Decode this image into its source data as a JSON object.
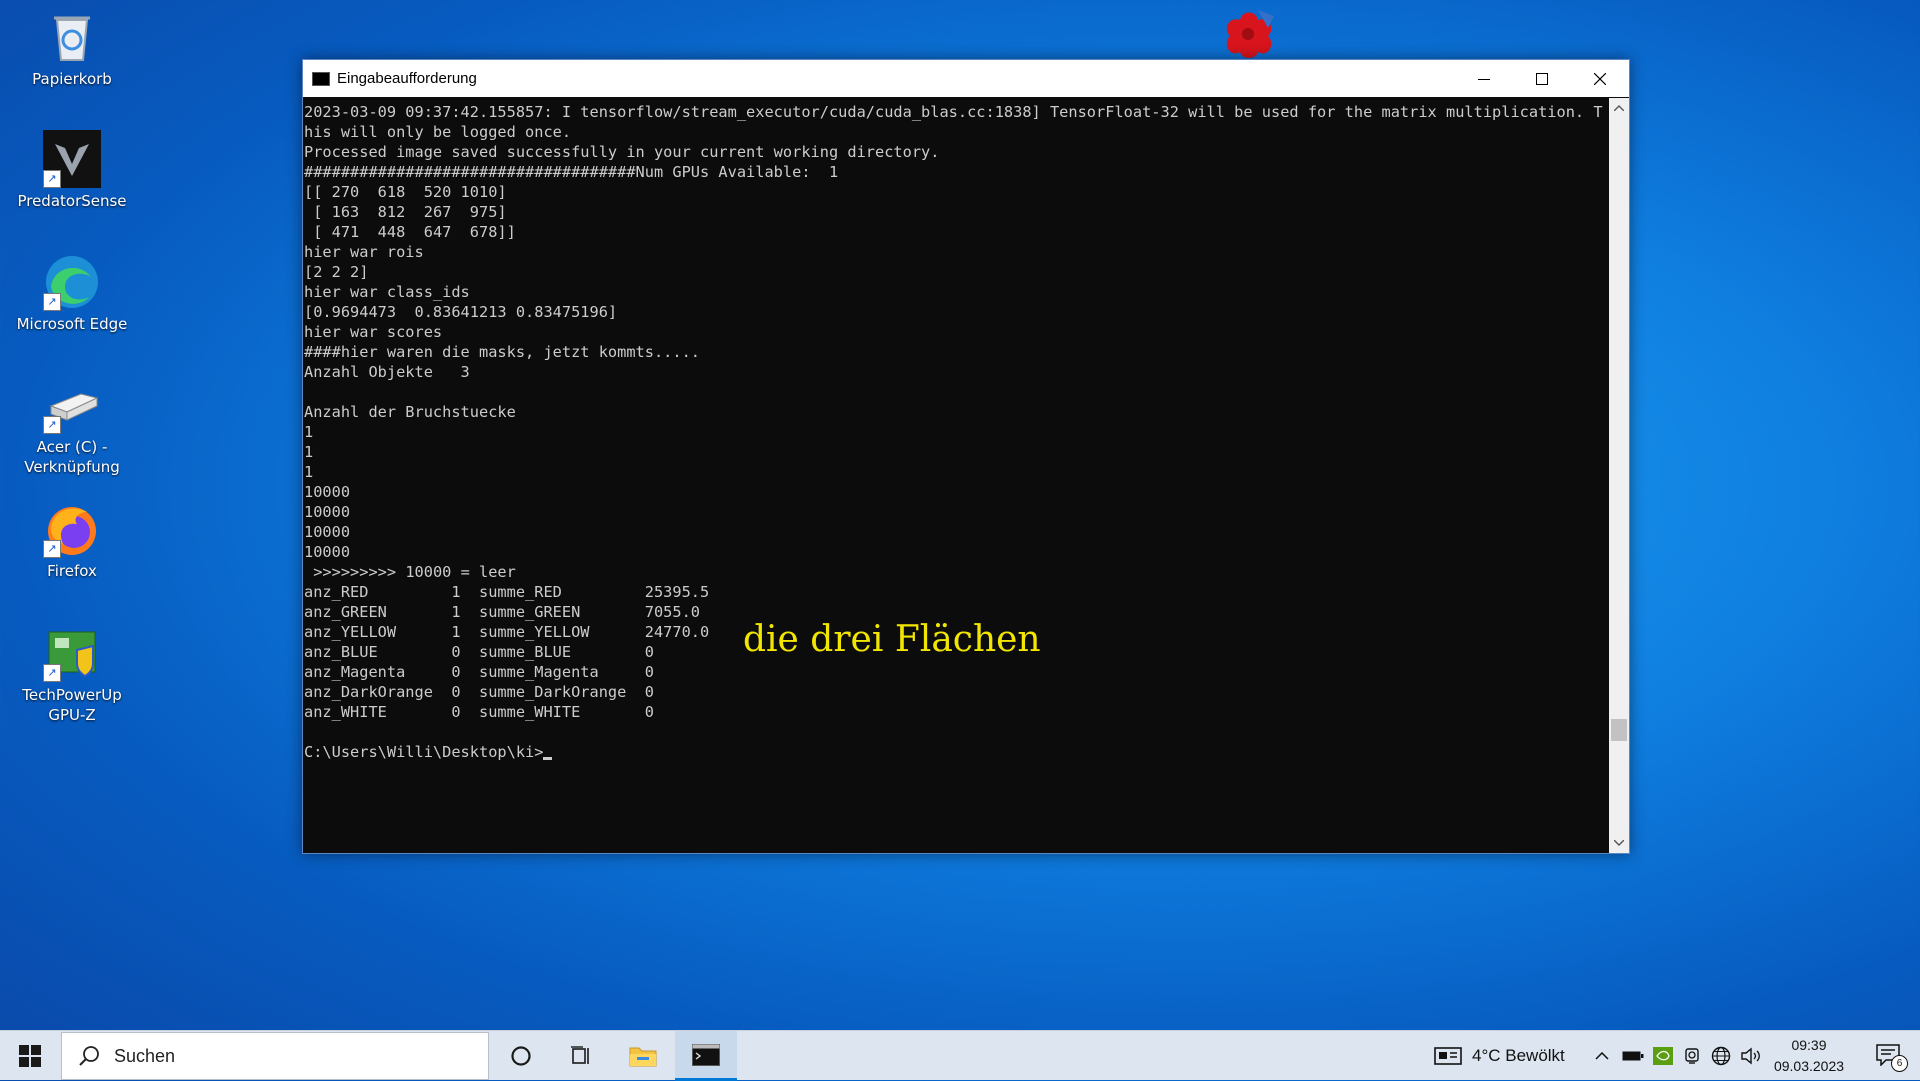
{
  "desktop": {
    "icons": [
      {
        "label": "Papierkorb",
        "icon": "recycle-bin-icon"
      },
      {
        "label": "PredatorSense",
        "icon": "predatorsense-icon"
      },
      {
        "label": "Microsoft Edge",
        "icon": "edge-icon"
      },
      {
        "label": "Acer (C) - Verknüpfung",
        "icon": "drive-icon"
      },
      {
        "label": "Firefox",
        "icon": "firefox-icon"
      },
      {
        "label": "TechPowerUp GPU-Z",
        "icon": "gpu-z-icon"
      }
    ]
  },
  "window": {
    "title": "Eingabeaufforderung",
    "buttons": {
      "minimize": "minimize-icon",
      "maximize": "maximize-icon",
      "close": "close-icon"
    },
    "lines": [
      "2023-03-09 09:37:42.155857: I tensorflow/stream_executor/cuda/cuda_blas.cc:1838] TensorFloat-32 will be used for the matrix multiplication. This will only be logged once.",
      "Processed image saved successfully in your current working directory.",
      "####################################Num GPUs Available:  1",
      "[[ 270  618  520 1010]",
      " [ 163  812  267  975]",
      " [ 471  448  647  678]]",
      "hier war rois",
      "[2 2 2]",
      "hier war class_ids",
      "[0.9694473  0.83641213 0.83475196]",
      "hier war scores",
      "####hier waren die masks, jetzt kommts.....",
      "Anzahl Objekte   3",
      "",
      "Anzahl der Bruchstuecke",
      "1",
      "1",
      "1",
      "10000",
      "10000",
      "10000",
      "10000",
      " >>>>>>>>> 10000 = leer",
      "anz_RED         1  summe_RED         25395.5",
      "anz_GREEN       1  summe_GREEN       7055.0",
      "anz_YELLOW      1  summe_YELLOW      24770.0",
      "anz_BLUE        0  summe_BLUE        0",
      "anz_Magenta     0  summe_Magenta     0",
      "anz_DarkOrange  0  summe_DarkOrange  0",
      "anz_WHITE       0  summe_WHITE       0",
      ""
    ],
    "prompt": "C:\\Users\\Willi\\Desktop\\ki>",
    "annotation": "die drei Flächen",
    "annotation_color": "#f2e600"
  },
  "taskbar": {
    "search_placeholder": "Suchen",
    "weather": "4°C  Bewölkt",
    "time": "09:39",
    "date": "09.03.2023",
    "notification_count": "6",
    "accent": "#0078d7"
  }
}
